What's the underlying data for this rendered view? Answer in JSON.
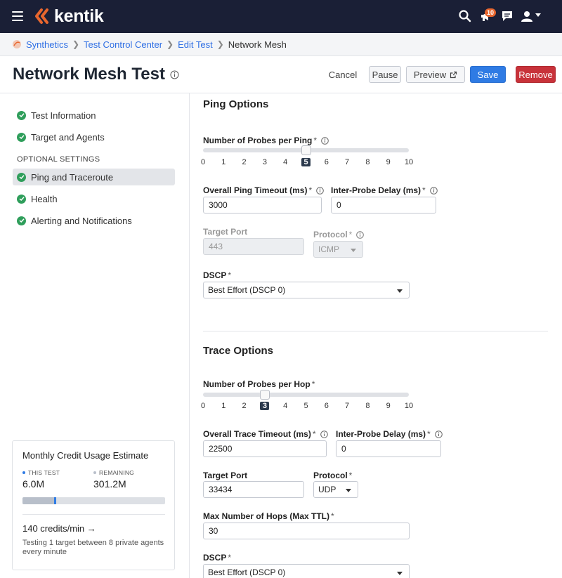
{
  "app": {
    "logo_text": "kentik",
    "notification_count": "10",
    "brand_color": "#e8662e",
    "nav_bg": "#1a1f36"
  },
  "breadcrumb": {
    "items": [
      "Synthetics",
      "Test Control Center",
      "Edit Test"
    ],
    "current": "Network Mesh"
  },
  "header": {
    "title": "Network Mesh Test",
    "cancel": "Cancel",
    "pause": "Pause",
    "preview": "Preview",
    "save": "Save",
    "remove": "Remove"
  },
  "sidebar": {
    "items": [
      {
        "label": "Test Information"
      },
      {
        "label": "Target and Agents"
      }
    ],
    "section_label": "OPTIONAL SETTINGS",
    "optional_items": [
      {
        "label": "Ping and Traceroute",
        "active": true
      },
      {
        "label": "Health"
      },
      {
        "label": "Alerting and Notifications"
      }
    ]
  },
  "credits": {
    "title": "Monthly Credit Usage Estimate",
    "this_test_label": "THIS TEST",
    "this_test_value": "6.0M",
    "remaining_label": "REMAINING",
    "remaining_value": "301.2M",
    "used_fraction": 0.22,
    "rate": "140 credits/min →",
    "description": "Testing 1 target between 8 private agents every minute"
  },
  "ping": {
    "title": "Ping Options",
    "probes_label": "Number of Probes per Ping",
    "probes_value": 5,
    "ticks": [
      "0",
      "1",
      "2",
      "3",
      "4",
      "5",
      "6",
      "7",
      "8",
      "9",
      "10"
    ],
    "timeout_label": "Overall Ping Timeout (ms)",
    "timeout_value": "3000",
    "delay_label": "Inter-Probe Delay (ms)",
    "delay_value": "0",
    "port_label": "Target Port",
    "port_value": "443",
    "protocol_label": "Protocol",
    "protocol_value": "ICMP",
    "dscp_label": "DSCP",
    "dscp_value": "Best Effort (DSCP 0)"
  },
  "trace": {
    "title": "Trace Options",
    "probes_label": "Number of Probes per Hop",
    "probes_value": 3,
    "ticks": [
      "0",
      "1",
      "2",
      "3",
      "4",
      "5",
      "6",
      "7",
      "8",
      "9",
      "10"
    ],
    "timeout_label": "Overall Trace Timeout (ms)",
    "timeout_value": "22500",
    "delay_label": "Inter-Probe Delay (ms)",
    "delay_value": "0",
    "port_label": "Target Port",
    "port_value": "33434",
    "protocol_label": "Protocol",
    "protocol_value": "UDP",
    "hops_label": "Max Number of Hops (Max TTL)",
    "hops_value": "30",
    "dscp_label": "DSCP",
    "dscp_value": "Best Effort (DSCP 0)"
  },
  "required_mark": "*"
}
